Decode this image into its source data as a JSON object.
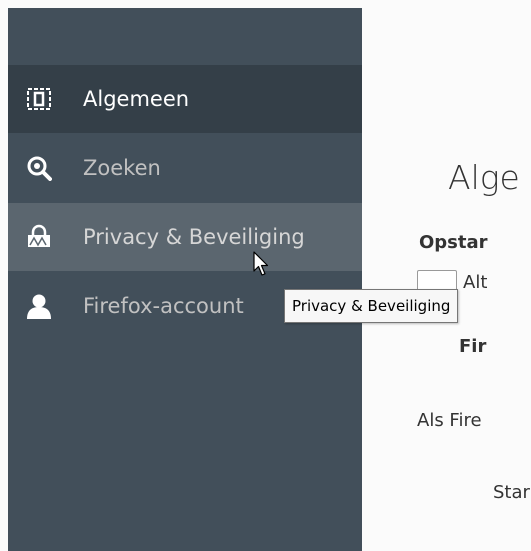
{
  "sidebar": {
    "items": [
      {
        "label": "Algemeen",
        "icon": "general-icon",
        "state": "selected"
      },
      {
        "label": "Zoeken",
        "icon": "search-icon",
        "state": "normal"
      },
      {
        "label": "Privacy & Beveiliging",
        "icon": "lock-icon",
        "state": "hover"
      },
      {
        "label": "Firefox-account",
        "icon": "account-icon",
        "state": "normal"
      }
    ]
  },
  "main": {
    "title": "Alge",
    "section_heading": "Opstar",
    "checkbox_label": "Alt",
    "firefox_heading": "Fir",
    "als_text": "Als Fire",
    "start_text": "Star"
  },
  "tooltip": {
    "text": "Privacy & Beveiliging"
  },
  "colors": {
    "sidebar_bg": "#424f5a",
    "sidebar_selected_bg": "#343f48",
    "sidebar_hover_bg": "#5b666f",
    "content_bg": "#fbfbfb"
  }
}
